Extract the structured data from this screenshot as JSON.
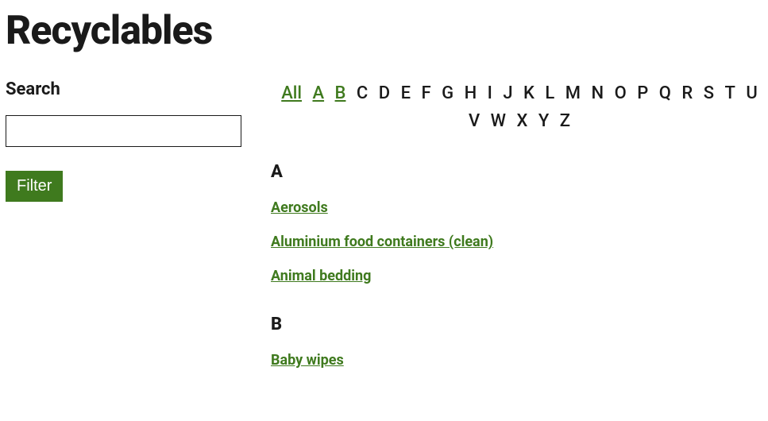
{
  "title": "Recyclables",
  "sidebar": {
    "search_label": "Search",
    "search_value": "",
    "search_placeholder": "",
    "filter_label": "Filter"
  },
  "az_nav": {
    "letters": [
      {
        "label": "All",
        "active": true
      },
      {
        "label": "A",
        "active": true
      },
      {
        "label": "B",
        "active": true
      },
      {
        "label": "C",
        "active": false
      },
      {
        "label": "D",
        "active": false
      },
      {
        "label": "E",
        "active": false
      },
      {
        "label": "F",
        "active": false
      },
      {
        "label": "G",
        "active": false
      },
      {
        "label": "H",
        "active": false
      },
      {
        "label": "I",
        "active": false
      },
      {
        "label": "J",
        "active": false
      },
      {
        "label": "K",
        "active": false
      },
      {
        "label": "L",
        "active": false
      },
      {
        "label": "M",
        "active": false
      },
      {
        "label": "N",
        "active": false
      },
      {
        "label": "O",
        "active": false
      },
      {
        "label": "P",
        "active": false
      },
      {
        "label": "Q",
        "active": false
      },
      {
        "label": "R",
        "active": false
      },
      {
        "label": "S",
        "active": false
      },
      {
        "label": "T",
        "active": false
      },
      {
        "label": "U",
        "active": false
      },
      {
        "label": "V",
        "active": false
      },
      {
        "label": "W",
        "active": false
      },
      {
        "label": "X",
        "active": false
      },
      {
        "label": "Y",
        "active": false
      },
      {
        "label": "Z",
        "active": false
      }
    ]
  },
  "sections": [
    {
      "heading": "A",
      "items": [
        "Aerosols",
        "Aluminium food containers (clean)",
        "Animal bedding"
      ]
    },
    {
      "heading": "B",
      "items": [
        "Baby wipes"
      ]
    }
  ]
}
